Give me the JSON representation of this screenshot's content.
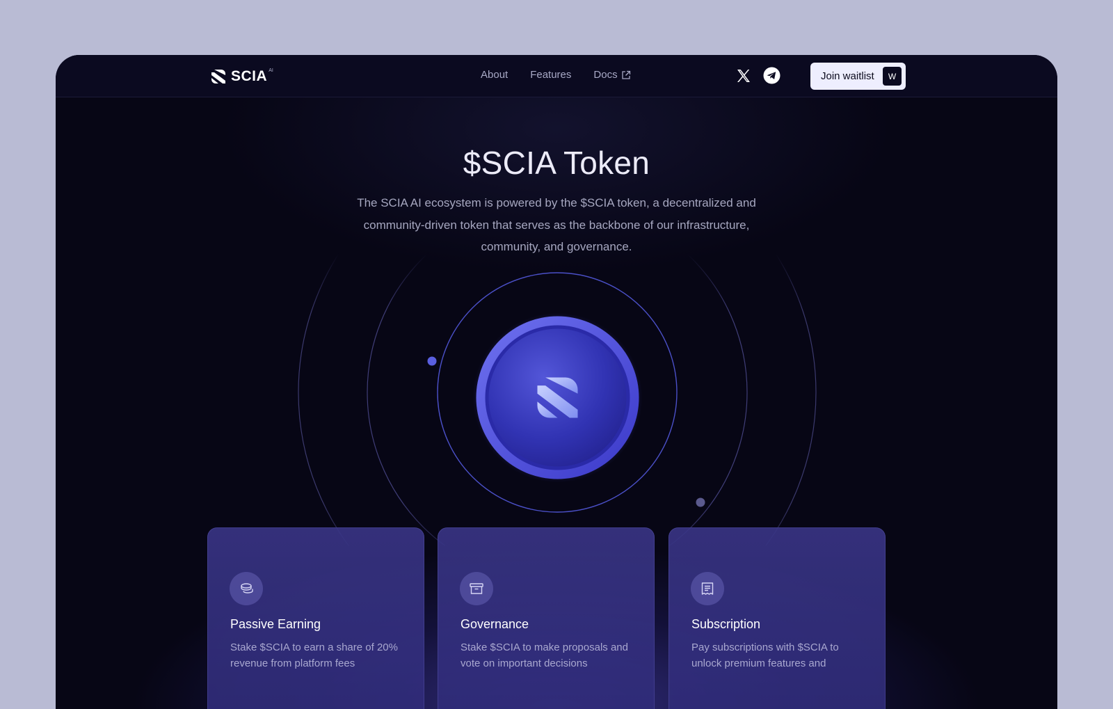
{
  "header": {
    "logo_text": "SCIA",
    "logo_sup": "AI",
    "nav": [
      {
        "label": "About"
      },
      {
        "label": "Features"
      },
      {
        "label": "Docs"
      }
    ],
    "social": [
      "x-icon",
      "telegram-icon"
    ],
    "waitlist_label": "Join waitlist",
    "waitlist_shortcut": "W"
  },
  "hero": {
    "title": "$SCIA Token",
    "subtitle": "The SCIA AI ecosystem is powered by the $SCIA token, a decentralized and community-driven token that serves as the backbone of our infrastructure, community, and governance."
  },
  "cards": [
    {
      "icon": "coins-icon",
      "title": "Passive Earning",
      "desc": "Stake $SCIA to earn a share of 20% revenue from platform fees"
    },
    {
      "icon": "archive-box-icon",
      "title": "Governance",
      "desc": "Stake $SCIA to make proposals and vote on important decisions"
    },
    {
      "icon": "receipt-icon",
      "title": "Subscription",
      "desc": "Pay subscriptions with $SCIA to unlock premium features and"
    }
  ],
  "colors": {
    "background": "#070615",
    "accent": "#5a5fe0",
    "card": "#3a3686",
    "button": "#eeeefe"
  }
}
